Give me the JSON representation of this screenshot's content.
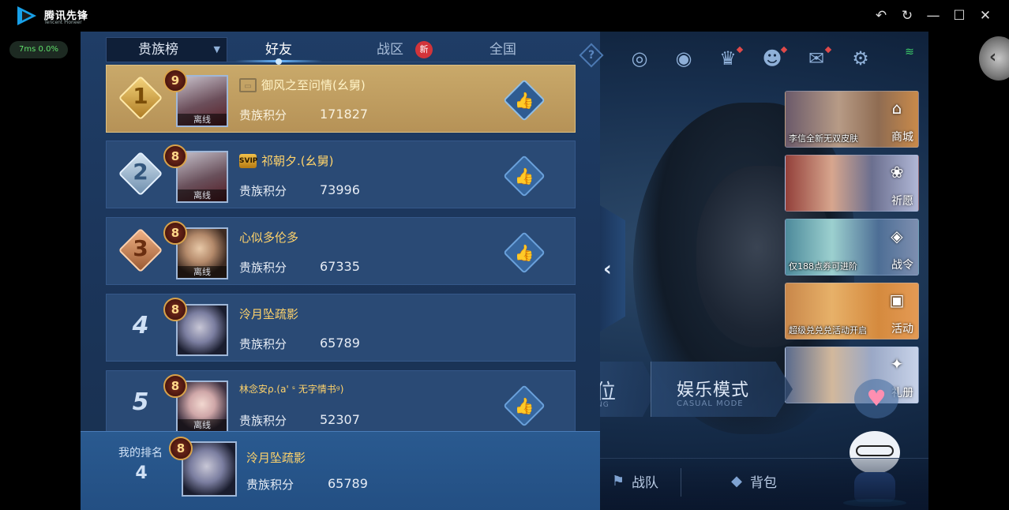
{
  "emulator": {
    "app_name": "腾讯先锋",
    "app_subname": "Tencent Pioneer",
    "fps_text": "7ms  0.0%"
  },
  "leaderboard": {
    "selector_label": "贵族榜",
    "tabs": [
      {
        "label": "好友",
        "active": true
      },
      {
        "label": "战区",
        "active": false
      },
      {
        "label": "全国",
        "active": false
      }
    ],
    "new_badge": "新",
    "help_icon": "?",
    "rows": [
      {
        "rank": "1",
        "level": "9",
        "name": "御风之至问情(幺舅)",
        "score_label": "贵族积分",
        "score": "171827",
        "status": "离线",
        "tag_icon": "nameplate-icon"
      },
      {
        "rank": "2",
        "level": "8",
        "name": "祁朝夕.(幺舅)",
        "score_label": "贵族积分",
        "score": "73996",
        "status": "离线",
        "tag_icon": "svip-icon",
        "tag_text": "SVIP"
      },
      {
        "rank": "3",
        "level": "8",
        "name": "心似多伦多",
        "score_label": "贵族积分",
        "score": "67335",
        "status": "离线"
      },
      {
        "rank": "4",
        "level": "8",
        "name": "泠月坠疏影",
        "score_label": "贵族积分",
        "score": "65789"
      },
      {
        "rank": "5",
        "level": "8",
        "name": "林念安ρ.(a' ˢ 无字情书ᵍ)",
        "score_label": "贵族积分",
        "score": "52307",
        "status": "离线"
      }
    ],
    "my_rank": {
      "label": "我的排名",
      "rank": "4",
      "level": "8",
      "name": "泠月坠疏影",
      "score_label": "贵族积分",
      "score": "65789"
    }
  },
  "lobby": {
    "shop_tiles": [
      {
        "caption": "李信全新无双皮肤",
        "label": "商城",
        "icon": "shop-icon"
      },
      {
        "caption": "",
        "label": "祈愿",
        "icon": "wish-icon"
      },
      {
        "caption": "仅188点券可进阶",
        "label": "战令",
        "icon": "battlepass-icon"
      },
      {
        "caption": "超级兑兑兑活动开启",
        "label": "活动",
        "icon": "event-icon"
      },
      {
        "caption": "",
        "label": "礼册",
        "icon": "giftbook-icon"
      }
    ],
    "mode_ranked": {
      "big": "位",
      "small": "NG"
    },
    "mode_casual": {
      "big": "娱乐模式",
      "small": "CASUAL MODE"
    },
    "bottom_items": [
      {
        "label": "战队",
        "icon": "team-icon"
      },
      {
        "label": "背包",
        "icon": "bag-icon"
      }
    ]
  },
  "colors": {
    "panel_bg": "#1f3d66",
    "first_row_gold": "#c9a96a",
    "name_gold": "#ffd36b"
  }
}
